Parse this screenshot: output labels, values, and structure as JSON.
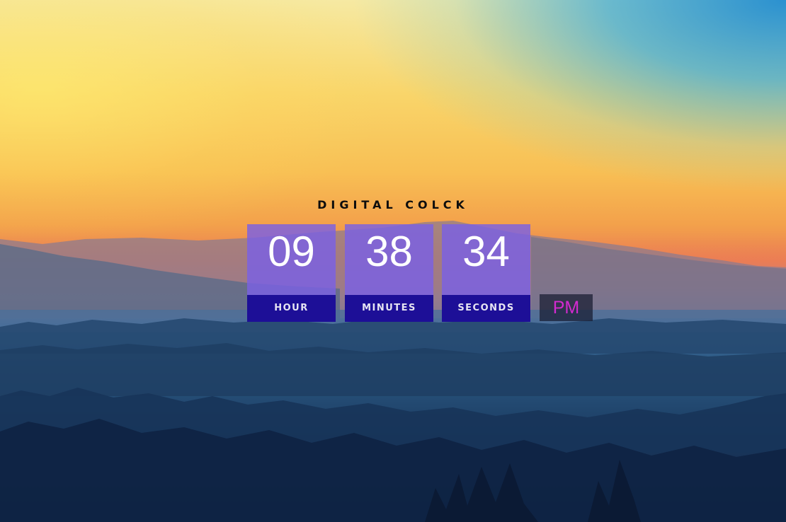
{
  "clock": {
    "title": "DIGITAL COLCK",
    "hour": {
      "value": "09",
      "label": "HOUR"
    },
    "minutes": {
      "value": "38",
      "label": "MINUTES"
    },
    "seconds": {
      "value": "34",
      "label": "SECONDS"
    },
    "period": "PM"
  },
  "colors": {
    "digit_box": "#7a60e4",
    "label_box": "#1d0f97",
    "period_text": "#d42ad0",
    "title_text": "#0d0d0d"
  }
}
